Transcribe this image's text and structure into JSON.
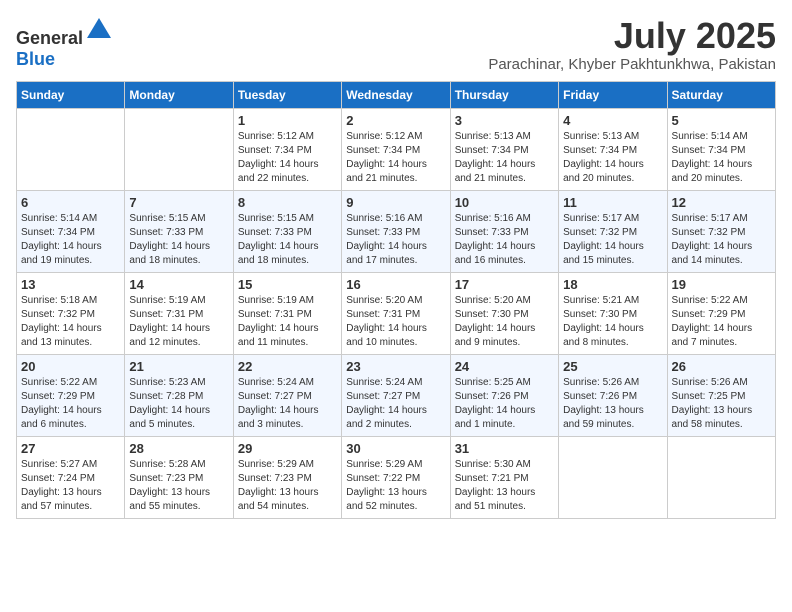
{
  "logo": {
    "text_general": "General",
    "text_blue": "Blue"
  },
  "title": {
    "month_year": "July 2025",
    "location": "Parachinar, Khyber Pakhtunkhwa, Pakistan"
  },
  "days_of_week": [
    "Sunday",
    "Monday",
    "Tuesday",
    "Wednesday",
    "Thursday",
    "Friday",
    "Saturday"
  ],
  "weeks": [
    [
      {
        "day": "",
        "info": ""
      },
      {
        "day": "",
        "info": ""
      },
      {
        "day": "1",
        "info": "Sunrise: 5:12 AM\nSunset: 7:34 PM\nDaylight: 14 hours and 22 minutes."
      },
      {
        "day": "2",
        "info": "Sunrise: 5:12 AM\nSunset: 7:34 PM\nDaylight: 14 hours and 21 minutes."
      },
      {
        "day": "3",
        "info": "Sunrise: 5:13 AM\nSunset: 7:34 PM\nDaylight: 14 hours and 21 minutes."
      },
      {
        "day": "4",
        "info": "Sunrise: 5:13 AM\nSunset: 7:34 PM\nDaylight: 14 hours and 20 minutes."
      },
      {
        "day": "5",
        "info": "Sunrise: 5:14 AM\nSunset: 7:34 PM\nDaylight: 14 hours and 20 minutes."
      }
    ],
    [
      {
        "day": "6",
        "info": "Sunrise: 5:14 AM\nSunset: 7:34 PM\nDaylight: 14 hours and 19 minutes."
      },
      {
        "day": "7",
        "info": "Sunrise: 5:15 AM\nSunset: 7:33 PM\nDaylight: 14 hours and 18 minutes."
      },
      {
        "day": "8",
        "info": "Sunrise: 5:15 AM\nSunset: 7:33 PM\nDaylight: 14 hours and 18 minutes."
      },
      {
        "day": "9",
        "info": "Sunrise: 5:16 AM\nSunset: 7:33 PM\nDaylight: 14 hours and 17 minutes."
      },
      {
        "day": "10",
        "info": "Sunrise: 5:16 AM\nSunset: 7:33 PM\nDaylight: 14 hours and 16 minutes."
      },
      {
        "day": "11",
        "info": "Sunrise: 5:17 AM\nSunset: 7:32 PM\nDaylight: 14 hours and 15 minutes."
      },
      {
        "day": "12",
        "info": "Sunrise: 5:17 AM\nSunset: 7:32 PM\nDaylight: 14 hours and 14 minutes."
      }
    ],
    [
      {
        "day": "13",
        "info": "Sunrise: 5:18 AM\nSunset: 7:32 PM\nDaylight: 14 hours and 13 minutes."
      },
      {
        "day": "14",
        "info": "Sunrise: 5:19 AM\nSunset: 7:31 PM\nDaylight: 14 hours and 12 minutes."
      },
      {
        "day": "15",
        "info": "Sunrise: 5:19 AM\nSunset: 7:31 PM\nDaylight: 14 hours and 11 minutes."
      },
      {
        "day": "16",
        "info": "Sunrise: 5:20 AM\nSunset: 7:31 PM\nDaylight: 14 hours and 10 minutes."
      },
      {
        "day": "17",
        "info": "Sunrise: 5:20 AM\nSunset: 7:30 PM\nDaylight: 14 hours and 9 minutes."
      },
      {
        "day": "18",
        "info": "Sunrise: 5:21 AM\nSunset: 7:30 PM\nDaylight: 14 hours and 8 minutes."
      },
      {
        "day": "19",
        "info": "Sunrise: 5:22 AM\nSunset: 7:29 PM\nDaylight: 14 hours and 7 minutes."
      }
    ],
    [
      {
        "day": "20",
        "info": "Sunrise: 5:22 AM\nSunset: 7:29 PM\nDaylight: 14 hours and 6 minutes."
      },
      {
        "day": "21",
        "info": "Sunrise: 5:23 AM\nSunset: 7:28 PM\nDaylight: 14 hours and 5 minutes."
      },
      {
        "day": "22",
        "info": "Sunrise: 5:24 AM\nSunset: 7:27 PM\nDaylight: 14 hours and 3 minutes."
      },
      {
        "day": "23",
        "info": "Sunrise: 5:24 AM\nSunset: 7:27 PM\nDaylight: 14 hours and 2 minutes."
      },
      {
        "day": "24",
        "info": "Sunrise: 5:25 AM\nSunset: 7:26 PM\nDaylight: 14 hours and 1 minute."
      },
      {
        "day": "25",
        "info": "Sunrise: 5:26 AM\nSunset: 7:26 PM\nDaylight: 13 hours and 59 minutes."
      },
      {
        "day": "26",
        "info": "Sunrise: 5:26 AM\nSunset: 7:25 PM\nDaylight: 13 hours and 58 minutes."
      }
    ],
    [
      {
        "day": "27",
        "info": "Sunrise: 5:27 AM\nSunset: 7:24 PM\nDaylight: 13 hours and 57 minutes."
      },
      {
        "day": "28",
        "info": "Sunrise: 5:28 AM\nSunset: 7:23 PM\nDaylight: 13 hours and 55 minutes."
      },
      {
        "day": "29",
        "info": "Sunrise: 5:29 AM\nSunset: 7:23 PM\nDaylight: 13 hours and 54 minutes."
      },
      {
        "day": "30",
        "info": "Sunrise: 5:29 AM\nSunset: 7:22 PM\nDaylight: 13 hours and 52 minutes."
      },
      {
        "day": "31",
        "info": "Sunrise: 5:30 AM\nSunset: 7:21 PM\nDaylight: 13 hours and 51 minutes."
      },
      {
        "day": "",
        "info": ""
      },
      {
        "day": "",
        "info": ""
      }
    ]
  ]
}
